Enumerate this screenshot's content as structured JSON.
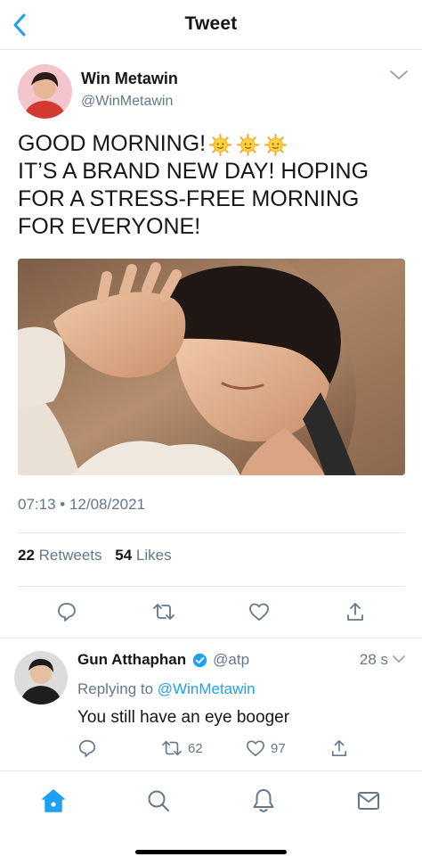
{
  "header": {
    "title": "Tweet"
  },
  "tweet": {
    "author_name": "Win Metawin",
    "author_handle": "@WinMetawin",
    "text_lines": [
      "GOOD MORNING!",
      "IT’S A BRAND NEW DAY! HOPING",
      "FOR A STRESS-FREE MORNING",
      "FOR EVERYONE!"
    ],
    "emoji": [
      "sun-with-face-icon",
      "sun-with-face-icon",
      "sun-with-face-icon"
    ],
    "timestamp": "07:13 • 12/08/2021",
    "retweets_count": "22",
    "retweets_label": "Retweets",
    "likes_count": "54",
    "likes_label": "Likes"
  },
  "reply": {
    "author_name": "Gun Atthaphan",
    "author_handle": "@atp",
    "time": "28 s",
    "replying_prefix": "Replying to",
    "replying_to": "@WinMetawin",
    "text": "You still have an eye booger",
    "retweet_count": "62",
    "like_count": "97"
  },
  "icons": {
    "back": "chevron-left-icon",
    "more": "chevron-down-icon",
    "reply": "comment-bubble-icon",
    "retweet": "retweet-icon",
    "like": "heart-icon",
    "share": "share-icon",
    "verified": "verified-badge-icon",
    "tabs": [
      "home-icon",
      "search-icon",
      "notifications-bell-icon",
      "messages-envelope-icon"
    ]
  },
  "colors": {
    "accent": "#1da1f2",
    "text": "#14171a",
    "secondary": "#657786",
    "divider": "#e1e8ed"
  }
}
